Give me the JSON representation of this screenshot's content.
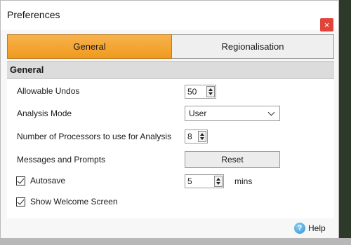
{
  "window": {
    "title": "Preferences",
    "close_glyph": "×"
  },
  "tabs": [
    {
      "label": "General",
      "selected": true
    },
    {
      "label": "Regionalisation",
      "selected": false
    }
  ],
  "section": {
    "title": "General"
  },
  "settings": {
    "allowable_undos": {
      "label": "Allowable Undos",
      "value": "50"
    },
    "analysis_mode": {
      "label": "Analysis Mode",
      "value": "User"
    },
    "processors": {
      "label": "Number of Processors to use for Analysis",
      "value": "8"
    },
    "messages": {
      "label": "Messages and Prompts",
      "button": "Reset"
    },
    "autosave": {
      "label": "Autosave",
      "checked": true,
      "value": "5",
      "unit": "mins"
    },
    "welcome": {
      "label": "Show Welcome Screen",
      "checked": true
    }
  },
  "footer": {
    "help_label": "Help",
    "help_glyph": "?"
  },
  "colors": {
    "accent": "#f0a030",
    "close": "#e0443a"
  },
  "icons": [
    "close-icon",
    "spin-up-icon",
    "spin-down-icon",
    "chevron-down-icon",
    "checkmark-icon",
    "help-icon"
  ]
}
